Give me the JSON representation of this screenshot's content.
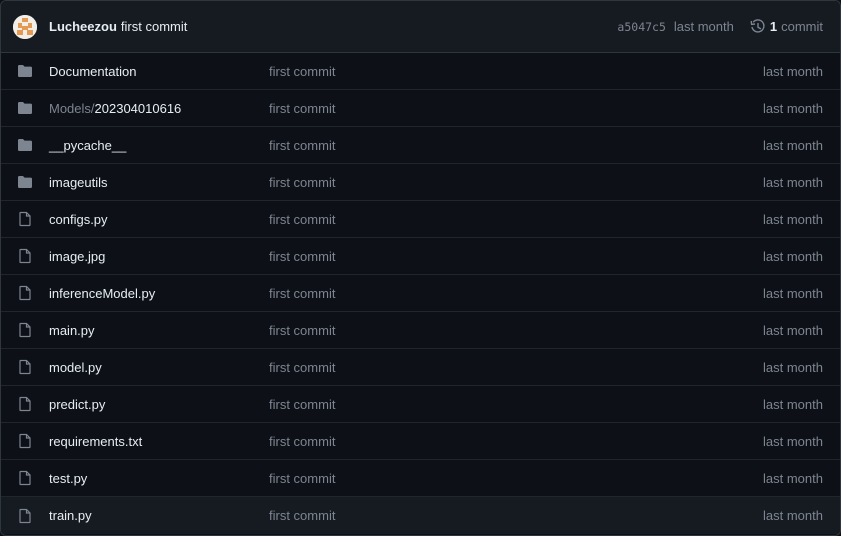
{
  "header": {
    "author": "Lucheezou",
    "commit_message": "first commit",
    "sha": "a5047c5",
    "time": "last month",
    "commit_count": "1",
    "commit_label": "commit"
  },
  "files": [
    {
      "type": "folder",
      "prefix": "",
      "name": "Documentation",
      "message": "first commit",
      "time": "last month"
    },
    {
      "type": "folder",
      "prefix": "Models/",
      "name": "202304010616",
      "message": "first commit",
      "time": "last month"
    },
    {
      "type": "folder",
      "prefix": "",
      "name": "__pycache__",
      "message": "first commit",
      "time": "last month"
    },
    {
      "type": "folder",
      "prefix": "",
      "name": "imageutils",
      "message": "first commit",
      "time": "last month"
    },
    {
      "type": "file",
      "prefix": "",
      "name": "configs.py",
      "message": "first commit",
      "time": "last month"
    },
    {
      "type": "file",
      "prefix": "",
      "name": "image.jpg",
      "message": "first commit",
      "time": "last month"
    },
    {
      "type": "file",
      "prefix": "",
      "name": "inferenceModel.py",
      "message": "first commit",
      "time": "last month"
    },
    {
      "type": "file",
      "prefix": "",
      "name": "main.py",
      "message": "first commit",
      "time": "last month"
    },
    {
      "type": "file",
      "prefix": "",
      "name": "model.py",
      "message": "first commit",
      "time": "last month"
    },
    {
      "type": "file",
      "prefix": "",
      "name": "predict.py",
      "message": "first commit",
      "time": "last month"
    },
    {
      "type": "file",
      "prefix": "",
      "name": "requirements.txt",
      "message": "first commit",
      "time": "last month"
    },
    {
      "type": "file",
      "prefix": "",
      "name": "test.py",
      "message": "first commit",
      "time": "last month"
    },
    {
      "type": "file",
      "prefix": "",
      "name": "train.py",
      "message": "first commit",
      "time": "last month"
    }
  ],
  "icons": {
    "folder": "folder-icon",
    "file": "file-icon",
    "history": "history-icon"
  },
  "colors": {
    "background": "#0d1117",
    "header_background": "#161b22",
    "border": "#30363d",
    "text": "#e6edf3",
    "muted": "#7d8590"
  }
}
